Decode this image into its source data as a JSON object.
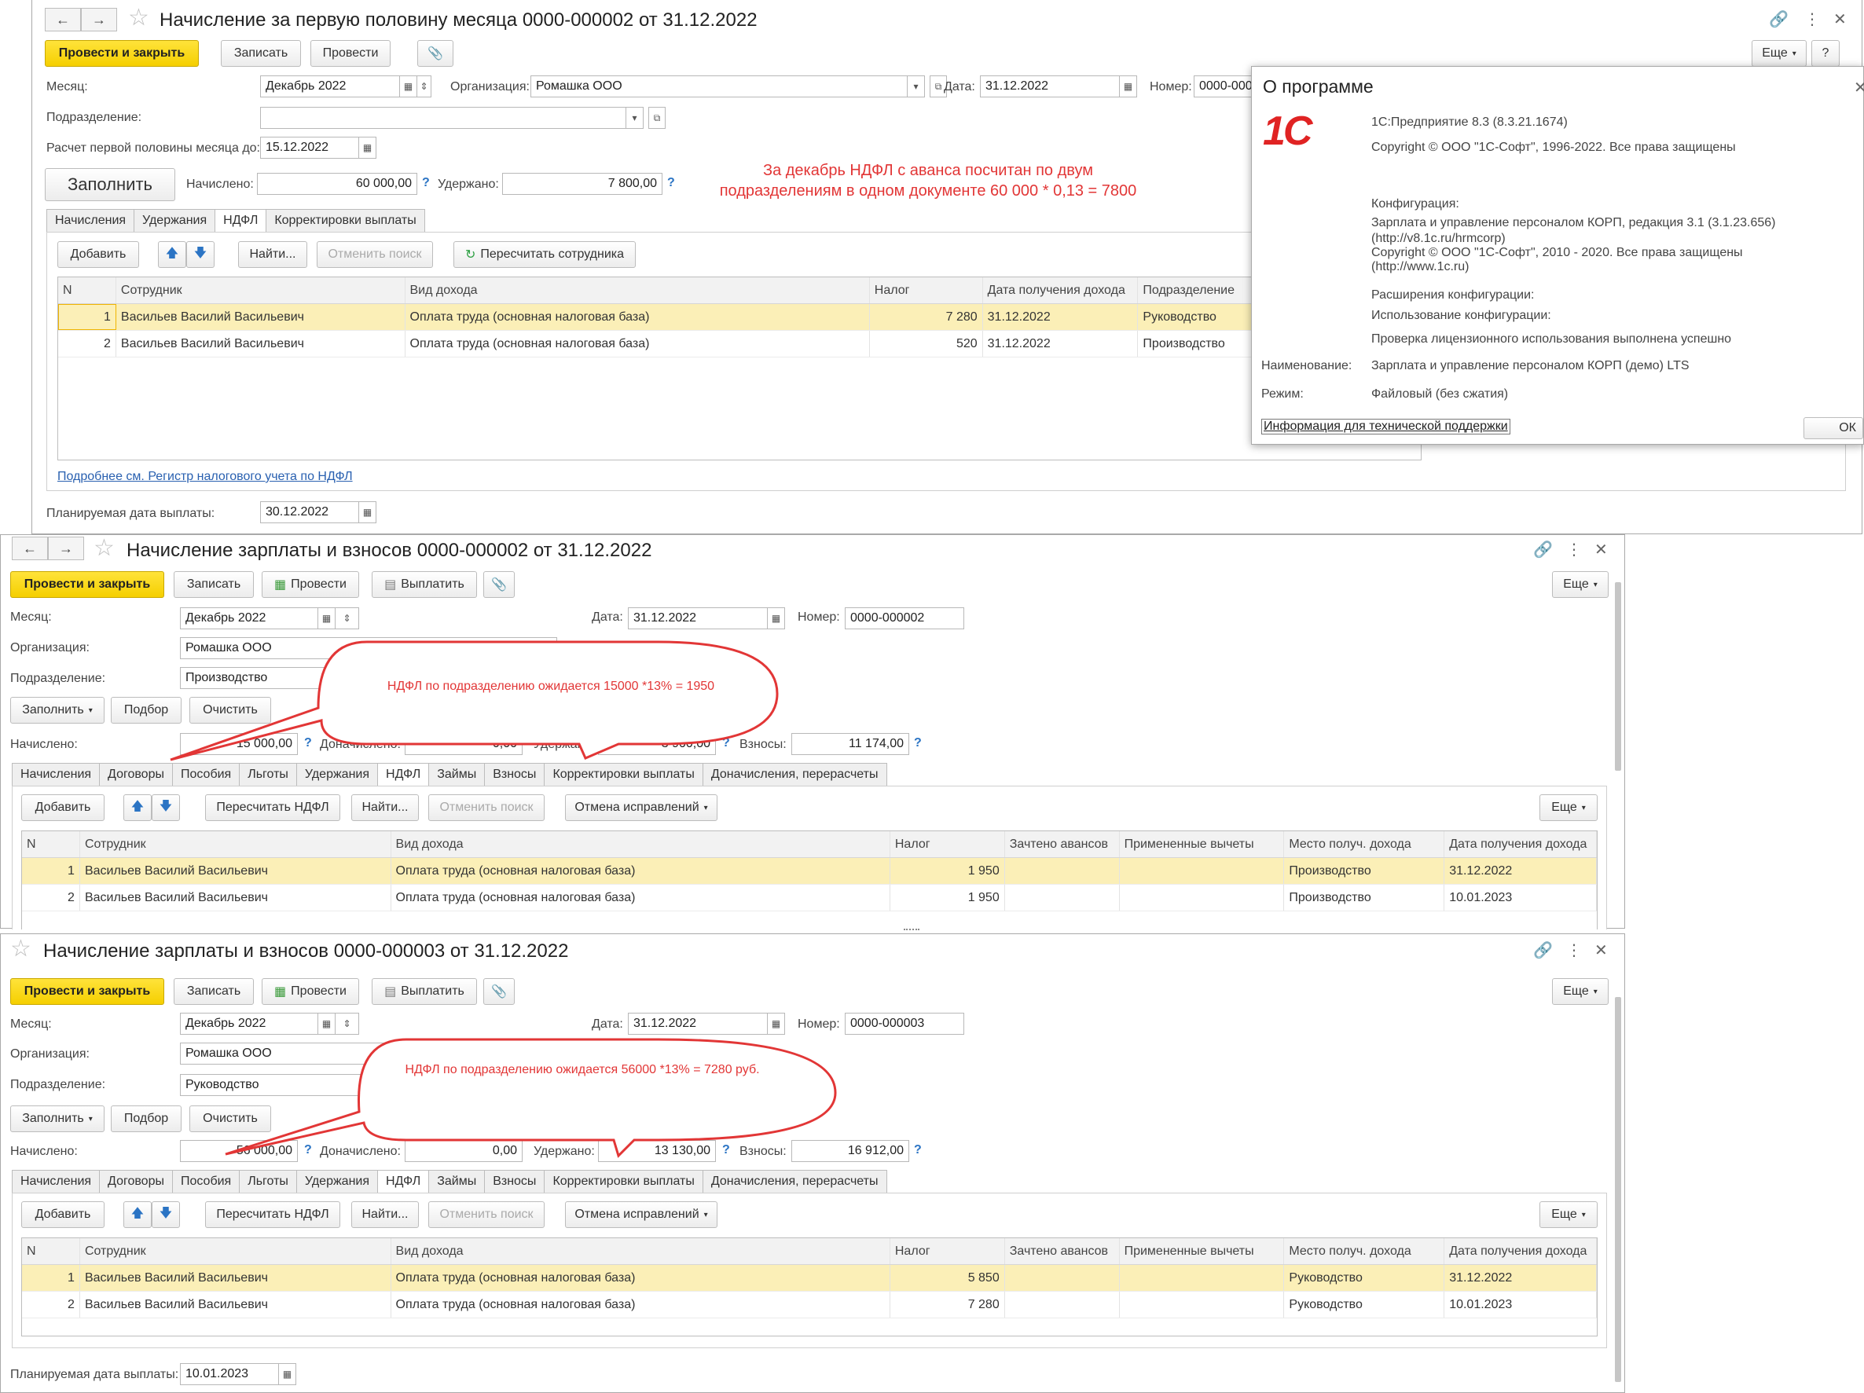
{
  "w1": {
    "title": "Начисление за первую половину месяца 0000-000002 от 31.12.2022",
    "post_close": "Провести и закрыть",
    "save": "Записать",
    "post": "Провести",
    "more": "Еще",
    "month_label": "Месяц:",
    "month": "Декабрь 2022",
    "org_label": "Организация:",
    "org": "Ромашка ООО",
    "date_label": "Дата:",
    "date": "31.12.2022",
    "number_label": "Номер:",
    "number": "0000-000",
    "dept_label": "Подразделение:",
    "calc_label": "Расчет первой половины месяца до:",
    "calc_date": "15.12.2022",
    "fill": "Заполнить",
    "accrued_label": "Начислено:",
    "accrued": "60 000,00",
    "withheld_label": "Удержано:",
    "withheld": "7 800,00",
    "tabs": [
      "Начисления",
      "Удержания",
      "НДФЛ",
      "Корректировки выплаты"
    ],
    "add": "Добавить",
    "find": "Найти...",
    "cancel_search": "Отменить поиск",
    "recalc": "Пересчитать сотрудника",
    "cols": [
      "N",
      "Сотрудник",
      "Вид дохода",
      "Налог",
      "Дата получения дохода",
      "Подразделение"
    ],
    "rows": [
      [
        "1",
        "Васильев Василий Васильевич",
        "Оплата труда (основная налоговая база)",
        "7 280",
        "31.12.2022",
        "Руководство"
      ],
      [
        "2",
        "Васильев Василий Васильевич",
        "Оплата труда (основная налоговая база)",
        "520",
        "31.12.2022",
        "Производство"
      ]
    ],
    "link": "Подробнее см. Регистр налогового учета по НДФЛ",
    "plan_label": "Планируемая дата выплаты:",
    "plan_date": "30.12.2022",
    "note": "За декабрь НДФЛ с аванса посчитан по двум подразделениям в одном документе 60 000 * 0,13 = 7800"
  },
  "about": {
    "title": "О программе",
    "product": "1С:Предприятие 8.3 (8.3.21.1674)",
    "copyright": "Copyright © ООО \"1С-Софт\", 1996-2022. Все права защищены",
    "config_label": "Конфигурация:",
    "config_line1": "Зарплата и управление персоналом КОРП, редакция 3.1 (3.1.23.656)",
    "config_line2": "(http://v8.1c.ru/hrmcorp)",
    "config_line3": "Copyright © ООО \"1С-Софт\", 2010 - 2020. Все права защищены",
    "config_line4": "(http://www.1c.ru)",
    "ext_label": "Расширения конфигурации:",
    "usage_label": "Использование конфигурации:",
    "license": "Проверка лицензионного использования выполнена успешно",
    "name_label": "Наименование:",
    "name": "Зарплата и управление персоналом КОРП (демо) LTS",
    "mode_label": "Режим:",
    "mode": "Файловый (без сжатия)",
    "support": "Информация для технической поддержки",
    "ok": "ОК",
    "logo": "1С"
  },
  "w2": {
    "title": "Начисление зарплаты и взносов 0000-000002 от 31.12.2022",
    "post_close": "Провести и закрыть",
    "save": "Записать",
    "post": "Провести",
    "pay": "Выплатить",
    "more": "Еще",
    "month_label": "Месяц:",
    "month": "Декабрь 2022",
    "date_label": "Дата:",
    "date": "31.12.2022",
    "number_label": "Номер:",
    "number": "0000-000002",
    "org_label": "Организация:",
    "org": "Ромашка ООО",
    "dept_label": "Подразделение:",
    "dept": "Производство",
    "fill": "Заполнить",
    "select": "Подбор",
    "clear": "Очистить",
    "accrued_label": "Начислено:",
    "accrued": "15 000,00",
    "extra_label": "Доначислено:",
    "extra": "0,00",
    "withheld_label": "Удержано:",
    "withheld": "3 900,00",
    "contrib_label": "Взносы:",
    "contrib": "11 174,00",
    "tabs": [
      "Начисления",
      "Договоры",
      "Пособия",
      "Льготы",
      "Удержания",
      "НДФЛ",
      "Займы",
      "Взносы",
      "Корректировки выплаты",
      "Доначисления, перерасчеты"
    ],
    "add": "Добавить",
    "recalc": "Пересчитать НДФЛ",
    "find": "Найти...",
    "cancel_search": "Отменить поиск",
    "cancel_fix": "Отмена исправлений",
    "cols": [
      "N",
      "Сотрудник",
      "Вид дохода",
      "Налог",
      "Зачтено авансов",
      "Примененные вычеты",
      "Место получ. дохода",
      "Дата получения дохода"
    ],
    "rows": [
      [
        "1",
        "Васильев Василий Васильевич",
        "Оплата труда (основная налоговая база)",
        "1 950",
        "",
        "",
        "Производство",
        "31.12.2022"
      ],
      [
        "2",
        "Васильев Василий Васильевич",
        "Оплата труда (основная налоговая база)",
        "1 950",
        "",
        "",
        "Производство",
        "10.01.2023"
      ]
    ],
    "callout": "НДФЛ по подразделению ожидается 15000 *13% = 1950"
  },
  "w3": {
    "title": "Начисление зарплаты и взносов 0000-000003 от 31.12.2022",
    "post_close": "Провести и закрыть",
    "save": "Записать",
    "post": "Провести",
    "pay": "Выплатить",
    "more": "Еще",
    "month_label": "Месяц:",
    "month": "Декабрь 2022",
    "date_label": "Дата:",
    "date": "31.12.2022",
    "number_label": "Номер:",
    "number": "0000-000003",
    "org_label": "Организация:",
    "org": "Ромашка ООО",
    "dept_label": "Подразделение:",
    "dept": "Руководство",
    "fill": "Заполнить",
    "select": "Подбор",
    "clear": "Очистить",
    "accrued_label": "Начислено:",
    "accrued": "56 000,00",
    "extra_label": "Доначислено:",
    "extra": "0,00",
    "withheld_label": "Удержано:",
    "withheld": "13 130,00",
    "contrib_label": "Взносы:",
    "contrib": "16 912,00",
    "tabs": [
      "Начисления",
      "Договоры",
      "Пособия",
      "Льготы",
      "Удержания",
      "НДФЛ",
      "Займы",
      "Взносы",
      "Корректировки выплаты",
      "Доначисления, перерасчеты"
    ],
    "add": "Добавить",
    "recalc": "Пересчитать НДФЛ",
    "find": "Найти...",
    "cancel_search": "Отменить поиск",
    "cancel_fix": "Отмена исправлений",
    "cols": [
      "N",
      "Сотрудник",
      "Вид дохода",
      "Налог",
      "Зачтено авансов",
      "Примененные вычеты",
      "Место получ. дохода",
      "Дата получения дохода"
    ],
    "rows": [
      [
        "1",
        "Васильев Василий Васильевич",
        "Оплата труда (основная налоговая база)",
        "5 850",
        "",
        "",
        "Руководство",
        "31.12.2022"
      ],
      [
        "2",
        "Васильев Василий Васильевич",
        "Оплата труда (основная налоговая база)",
        "7 280",
        "",
        "",
        "Руководство",
        "10.01.2023"
      ]
    ],
    "plan_label": "Планируемая дата выплаты:",
    "plan_date": "10.01.2023",
    "callout": "НДФЛ по подразделению ожидается 56000 *13% = 7280 руб."
  },
  "icons": {
    "back": "arrow-left-icon",
    "forward": "arrow-right-icon",
    "star": "star-icon",
    "link": "link-icon",
    "menu": "vertical-dots-icon",
    "close": "close-icon",
    "clip": "paperclip-icon",
    "calendar": "calendar-icon",
    "up": "arrow-up-icon",
    "down": "arrow-down-icon",
    "refresh": "refresh-icon",
    "post": "post-doc-icon",
    "pay": "pay-icon"
  },
  "colors": {
    "accent": "#f5cf00",
    "note_red": "#e23636",
    "selected_row": "#fbefb7",
    "link": "#2960b0"
  }
}
